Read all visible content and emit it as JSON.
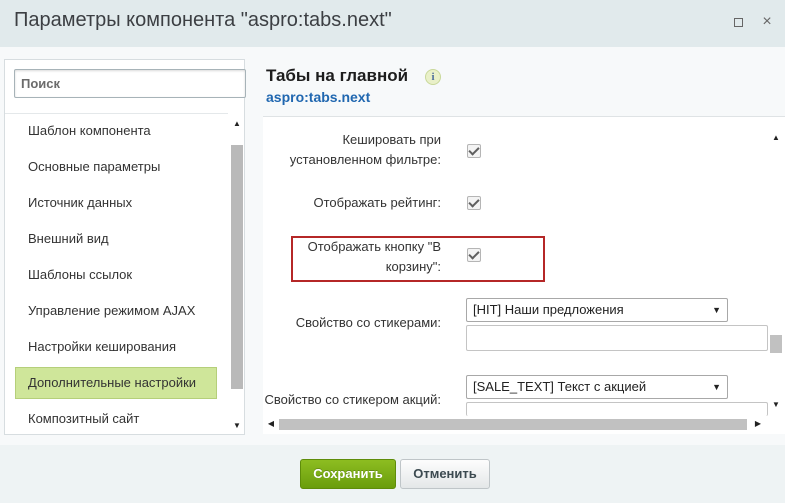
{
  "window": {
    "title": "Параметры компонента \"aspro:tabs.next\"",
    "maximize_icon": "maximize-icon",
    "close_icon": "close-icon",
    "close_glyph": "×"
  },
  "sidebar": {
    "search_placeholder": "Поиск",
    "items": [
      {
        "label": "Шаблон компонента",
        "active": false
      },
      {
        "label": "Основные параметры",
        "active": false
      },
      {
        "label": "Источник данных",
        "active": false
      },
      {
        "label": "Внешний вид",
        "active": false
      },
      {
        "label": "Шаблоны ссылок",
        "active": false
      },
      {
        "label": "Управление режимом AJAX",
        "active": false
      },
      {
        "label": "Настройки кеширования",
        "active": false
      },
      {
        "label": "Дополнительные настройки",
        "active": true
      },
      {
        "label": "Композитный сайт",
        "active": false
      }
    ]
  },
  "panel": {
    "title": "Табы на главной",
    "info_glyph": "i",
    "subtitle": "aspro:tabs.next",
    "fields": {
      "cache_filter": {
        "label_line1": "Кешировать при",
        "label_line2": "установленном фильтре:",
        "checked": true
      },
      "show_rating": {
        "label": "Отображать рейтинг:",
        "checked": true
      },
      "show_basket": {
        "label_line1": "Отображать кнопку \"В",
        "label_line2": "корзину\":",
        "checked": true
      },
      "stickers_prop": {
        "label": "Свойство со стикерами:",
        "value": "[HIT] Наши предложения"
      },
      "sale_sticker_prop": {
        "label": "Свойство со стикером акций:",
        "value": "[SALE_TEXT] Текст с акцией"
      }
    }
  },
  "footer": {
    "save_label": "Сохранить",
    "cancel_label": "Отменить"
  },
  "colors": {
    "active_item": "#cfe69a",
    "save_button": "#7aad16",
    "subtitle_link": "#2067b0",
    "highlight_border": "#b52727"
  }
}
